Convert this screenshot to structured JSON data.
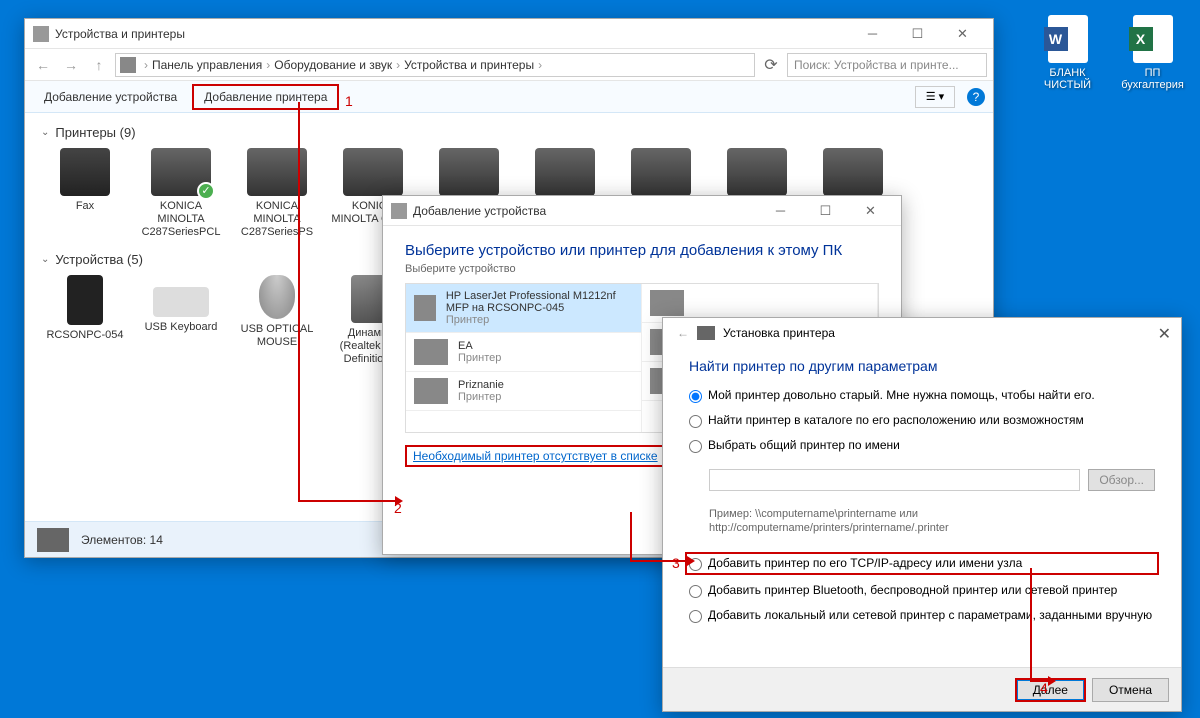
{
  "desktop": {
    "icons": [
      {
        "label": "БЛАНК ЧИСТЫЙ",
        "type": "word"
      },
      {
        "label": "ПП бухгалтерия",
        "type": "excel"
      }
    ]
  },
  "mainWindow": {
    "title": "Устройства и принтеры",
    "breadcrumb": [
      "Панель управления",
      "Оборудование и звук",
      "Устройства и принтеры"
    ],
    "searchPlaceholder": "Поиск: Устройства и принте...",
    "toolbar": {
      "addDevice": "Добавление устройства",
      "addPrinter": "Добавление принтера"
    },
    "sections": {
      "printers": {
        "label": "Принтеры (9)"
      },
      "devices": {
        "label": "Устройства (5)"
      }
    },
    "printers": [
      {
        "name": "Fax",
        "default": false,
        "type": "fax"
      },
      {
        "name": "KONICA MINOLTA C287SeriesPCL",
        "default": true,
        "type": "printer"
      },
      {
        "name": "KONICA MINOLTA C287SeriesPS",
        "default": false,
        "type": "printer"
      },
      {
        "name": "KONICA MINOLTA C287S",
        "default": false,
        "type": "printer"
      }
    ],
    "devices": [
      {
        "name": "RCSONPC-054",
        "type": "pc"
      },
      {
        "name": "USB Keyboard",
        "type": "keyboard"
      },
      {
        "name": "USB OPTICAL MOUSE",
        "type": "mouse"
      },
      {
        "name": "Динамики (Realtek High Definition...)",
        "type": "speaker"
      }
    ],
    "statusbar": "Элементов: 14"
  },
  "dialog1": {
    "title": "Добавление устройства",
    "heading": "Выберите устройство или принтер для добавления к этому ПК",
    "subheading": "Выберите устройство",
    "list": [
      {
        "name": "HP LaserJet Professional M1212nf MFP на RCSONPC-045",
        "type": "Принтер",
        "selected": true
      },
      {
        "name": "EA",
        "type": "Принтер",
        "selected": false
      },
      {
        "name": "Priznanie",
        "type": "Принтер",
        "selected": false
      }
    ],
    "notListedLink": "Необходимый принтер отсутствует в списке"
  },
  "dialog2": {
    "wizTitle": "Установка принтера",
    "heading": "Найти принтер по другим параметрам",
    "options": [
      "Мой принтер довольно старый. Мне нужна помощь, чтобы найти его.",
      "Найти принтер в каталоге по его расположению или возможностям",
      "Выбрать общий принтер по имени",
      "Добавить принтер по его TCP/IP-адресу или имени узла",
      "Добавить принтер Bluetooth, беспроводной принтер или сетевой принтер",
      "Добавить локальный или сетевой принтер с параметрами, заданными вручную"
    ],
    "browseBtn": "Обзор...",
    "example": "Пример: \\\\computername\\printername или http://computername/printers/printername/.printer",
    "nextBtn": "Далее",
    "cancelBtn": "Отмена"
  },
  "annotations": {
    "n1": "1",
    "n2": "2",
    "n3": "3",
    "n4": "4"
  }
}
